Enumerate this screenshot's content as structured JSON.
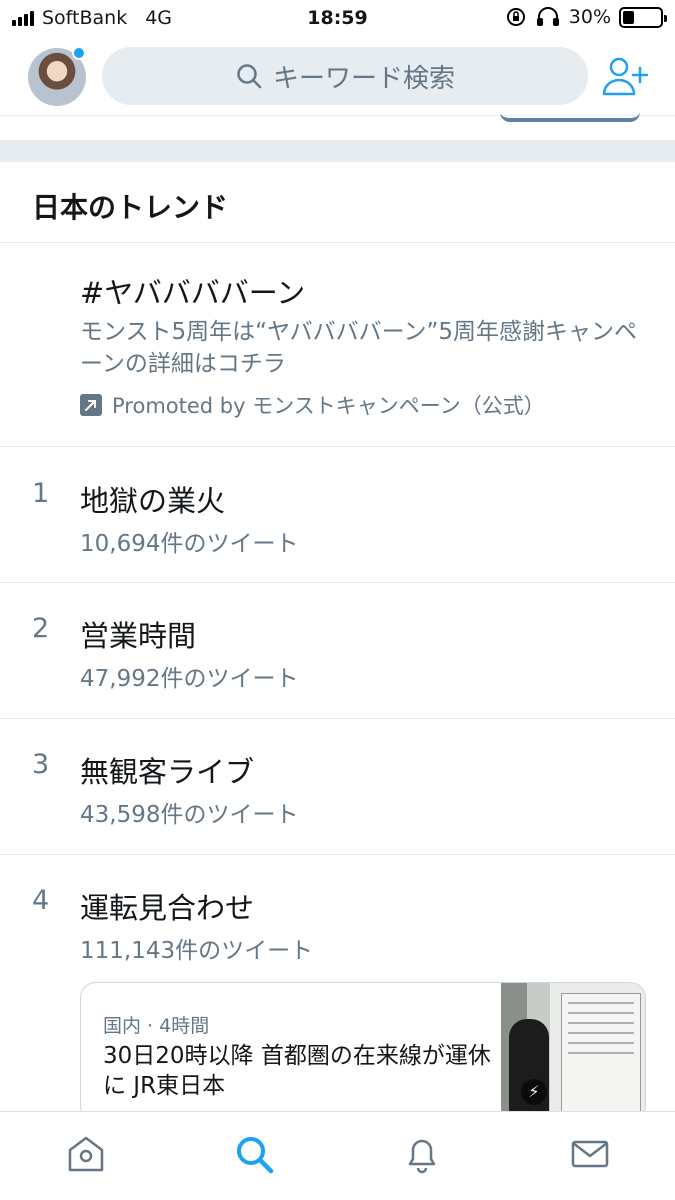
{
  "status_bar": {
    "carrier": "SoftBank",
    "network": "4G",
    "time": "18:59",
    "battery_percent": "30%",
    "battery_level": 0.3
  },
  "header": {
    "search_placeholder": "キーワード検索",
    "avatar_icon": "profile-avatar",
    "add_user_icon": "add-user-icon",
    "accent_color": "#1da1f2"
  },
  "trends": {
    "title": "日本のトレンド",
    "promoted": {
      "name": "#ヤババババーン",
      "description": "モンスト5周年は“ヤババババーン”5周年感謝キャンペーンの詳細はコチラ",
      "promoted_by": "Promoted by モンストキャンペーン（公式）"
    },
    "items": [
      {
        "rank": "1",
        "name": "地獄の業火",
        "count": "10,694件のツイート"
      },
      {
        "rank": "2",
        "name": "営業時間",
        "count": "47,992件のツイート"
      },
      {
        "rank": "3",
        "name": "無観客ライブ",
        "count": "43,598件のツイート"
      },
      {
        "rank": "4",
        "name": "運転見合わせ",
        "count": "111,143件のツイート"
      }
    ],
    "news_card": {
      "meta": "国内 · 4時間",
      "headline": "30日20時以降 首都圏の在来線が運休に JR東日本"
    }
  },
  "tab_bar": {
    "tabs": [
      "home-icon",
      "search-icon",
      "notifications-icon",
      "messages-icon"
    ],
    "active": "search-icon"
  }
}
